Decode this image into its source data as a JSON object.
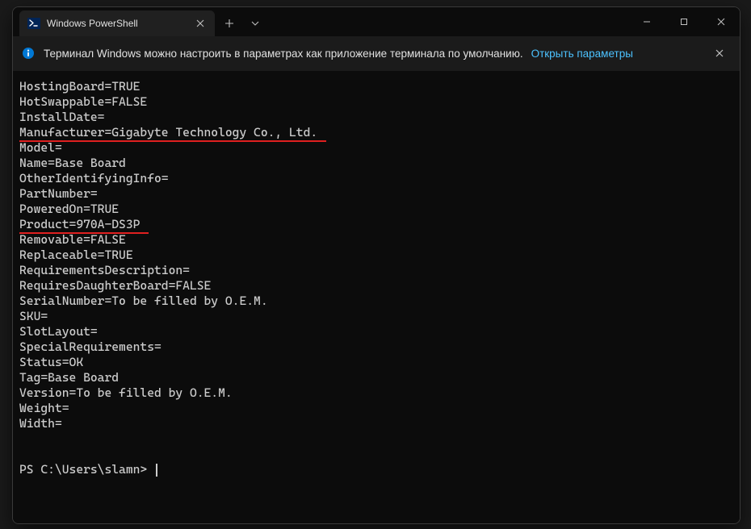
{
  "titlebar": {
    "tab_title": "Windows PowerShell"
  },
  "infobar": {
    "message": "Терминал Windows можно настроить в параметрах как приложение терминала по умолчанию.",
    "link": "Открыть параметры"
  },
  "output": {
    "lines": [
      "HostingBoard=TRUE",
      "HotSwappable=FALSE",
      "InstallDate=",
      "Manufacturer=Gigabyte Technology Co., Ltd.",
      "Model=",
      "Name=Base Board",
      "OtherIdentifyingInfo=",
      "PartNumber=",
      "PoweredOn=TRUE",
      "Product=970A-DS3P",
      "Removable=FALSE",
      "Replaceable=TRUE",
      "RequirementsDescription=",
      "RequiresDaughterBoard=FALSE",
      "SerialNumber=To be filled by O.E.M.",
      "SKU=",
      "SlotLayout=",
      "SpecialRequirements=",
      "Status=OK",
      "Tag=Base Board",
      "Version=To be filled by O.E.M.",
      "Weight=",
      "Width="
    ],
    "underlined_indices": {
      "3": "underline-red-1",
      "9": "underline-red-2"
    },
    "prompt": "PS C:\\Users\\slamn> "
  }
}
